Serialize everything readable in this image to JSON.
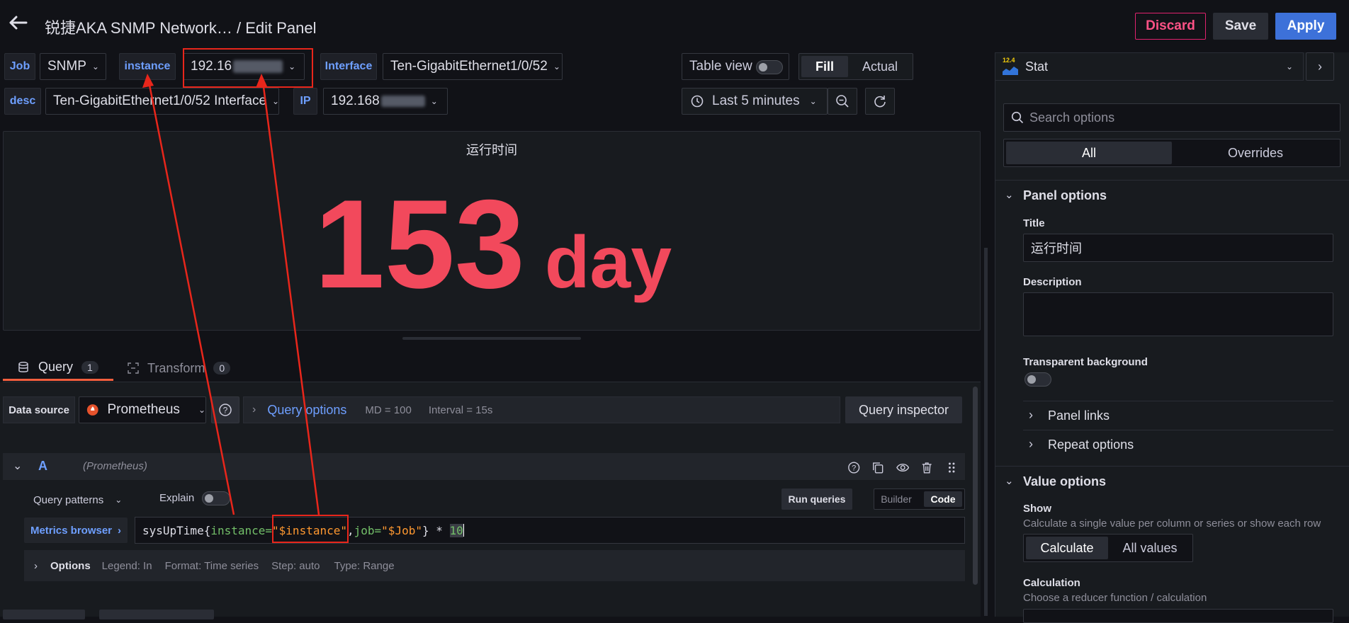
{
  "header": {
    "title": "锐捷AKA SNMP Network… / Edit Panel",
    "discard": "Discard",
    "save": "Save",
    "apply": "Apply"
  },
  "variables": {
    "job_label": "Job",
    "job_value": "SNMP",
    "instance_label": "instance",
    "instance_value": "192.16",
    "interface_label": "Interface",
    "interface_value": "Ten-GigabitEthernet1/0/52",
    "desc_label": "desc",
    "desc_value": "Ten-GigabitEthernet1/0/52 Interface",
    "ip_label": "IP",
    "ip_value": "192.168"
  },
  "view": {
    "table_view": "Table view",
    "fill": "Fill",
    "actual": "Actual",
    "time_range": "Last 5 minutes"
  },
  "panel": {
    "title": "运行时间",
    "value": "153",
    "unit": "day",
    "value_color": "#f2495c"
  },
  "query_tabs": [
    {
      "label": "Query",
      "count": "1"
    },
    {
      "label": "Transform",
      "count": "0"
    }
  ],
  "datasource": {
    "label": "Data source",
    "name": "Prometheus",
    "query_options": "Query options",
    "md": "MD = 100",
    "interval": "Interval = 15s",
    "inspector": "Query inspector"
  },
  "query": {
    "ref": "A",
    "ds_hint": "(Prometheus)",
    "patterns": "Query patterns",
    "explain": "Explain",
    "run": "Run queries",
    "builder": "Builder",
    "code": "Code",
    "metrics_browser": "Metrics browser",
    "expr_metric": "sysUpTime{",
    "expr_k1": "instance=",
    "expr_v1": "\"$instance\"",
    "expr_sep": ",",
    "expr_k2": "job=",
    "expr_v2": "\"$Job\"",
    "expr_end": "} * ",
    "expr_num": "10",
    "options": "Options",
    "legend": "Legend: In",
    "format": "Format: Time series",
    "step": "Step: auto",
    "type": "Type: Range"
  },
  "sidebar": {
    "viz_icon_text": "12.4",
    "viz": "Stat",
    "search_placeholder": "Search options",
    "tab_all": "All",
    "tab_overrides": "Overrides",
    "panel_options": "Panel options",
    "title_label": "Title",
    "title_value": "运行时间",
    "description_label": "Description",
    "transparent_label": "Transparent background",
    "panel_links": "Panel links",
    "repeat_options": "Repeat options",
    "value_options": "Value options",
    "show_label": "Show",
    "show_desc": "Calculate a single value per column or series or show each row",
    "calculate": "Calculate",
    "all_values": "All values",
    "calculation_label": "Calculation",
    "calculation_desc": "Choose a reducer function / calculation"
  },
  "colors": {
    "accent": "#3d71d9",
    "discard": "#e0226e",
    "annotation": "#e8261b"
  }
}
